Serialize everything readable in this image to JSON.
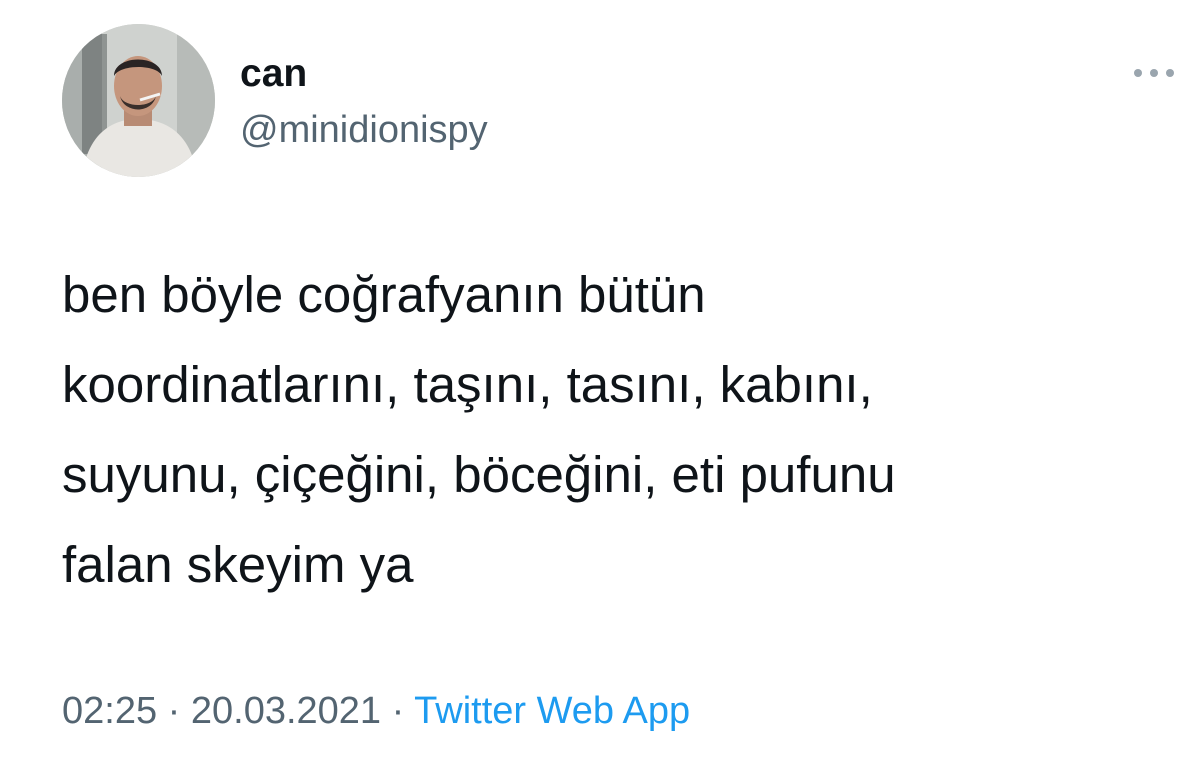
{
  "tweet": {
    "user": {
      "display_name": "can",
      "handle": "@minidionispy"
    },
    "text_lines": [
      "ben böyle coğrafyanın bütün",
      "koordinatlarını, taşını, tasını, kabını,",
      "suyunu, çiçeğini, böceğini, eti pufunu",
      "falan skeyim ya"
    ],
    "time": "02:25",
    "separator": " · ",
    "date": "20.03.2021",
    "source": "Twitter Web App"
  },
  "icons": {
    "more": "more-horizontal-icon"
  },
  "colors": {
    "text_primary": "#0f1419",
    "text_secondary": "#536471",
    "link": "#1d9bf0",
    "background": "#ffffff"
  }
}
